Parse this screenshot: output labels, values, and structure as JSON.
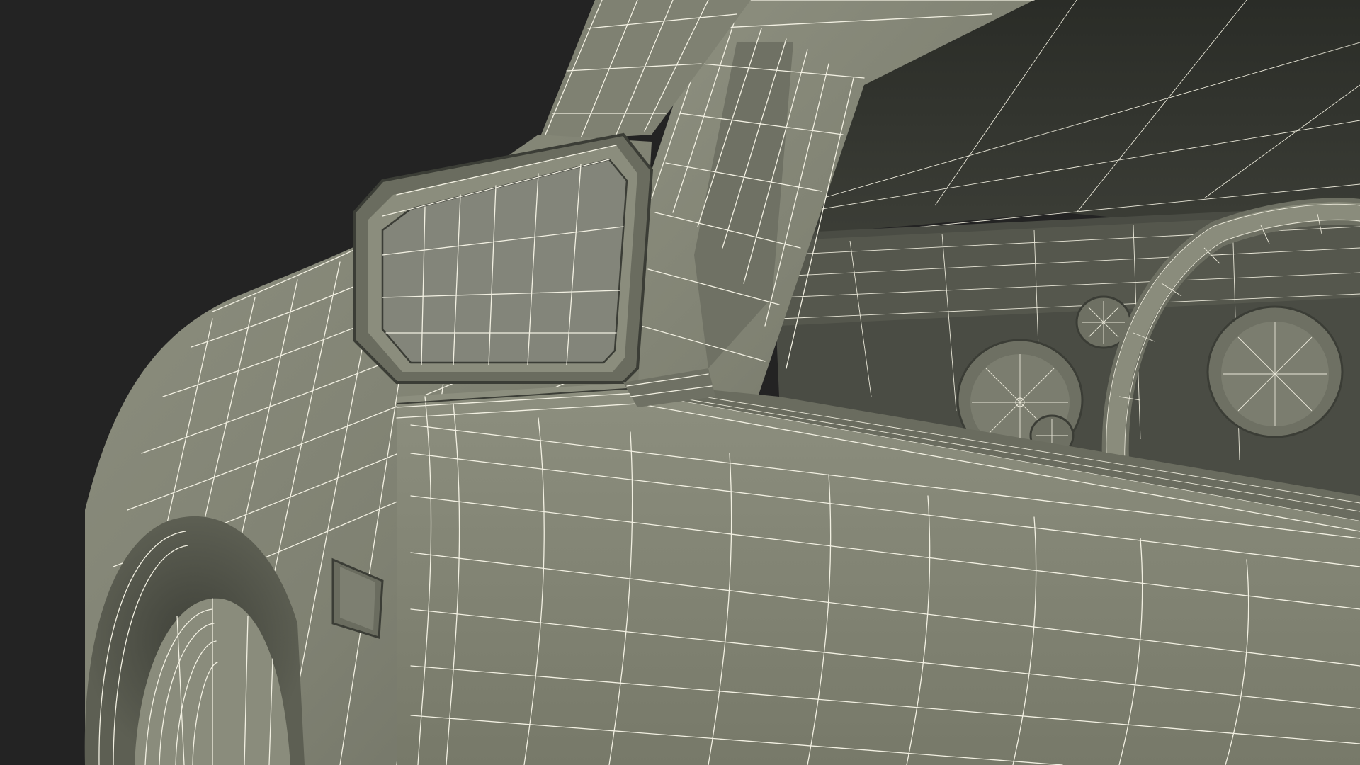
{
  "scene": {
    "subject": "car-front-left-wireframe",
    "render_mode": "wireframe-on-shaded",
    "colors": {
      "background": "#232323",
      "body_surface": "#8a8c7c",
      "body_shadow": "#5d5f53",
      "body_dark": "#3e4039",
      "interior_dark": "#2a2c27",
      "wire": "#f2f0e2",
      "edge": "#3b3d36"
    },
    "parts": [
      "side-mirror",
      "a-pillar",
      "windshield",
      "dashboard",
      "steering-wheel",
      "instrument-gauges",
      "front-fender",
      "front-wheel",
      "door-panel",
      "side-marker-light"
    ]
  }
}
